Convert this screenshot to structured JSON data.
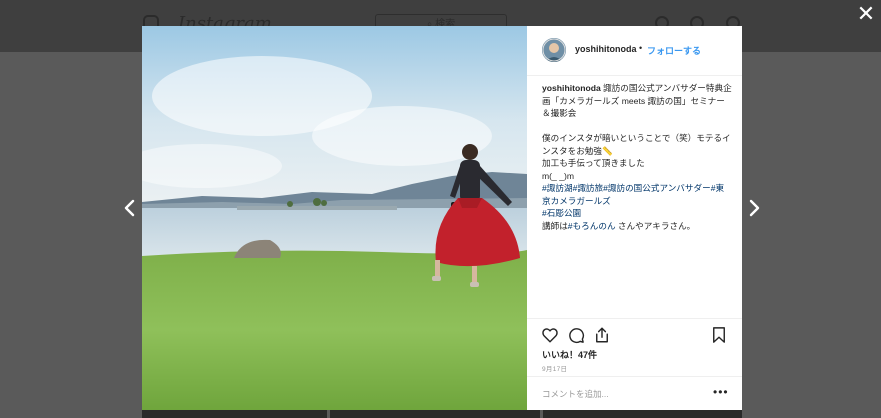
{
  "background": {
    "logo_text": "Instagram",
    "search_placeholder": "⌕ 検索"
  },
  "post": {
    "username": "yoshihitonoda",
    "separator": "•",
    "follow_label": "フォローする",
    "caption_user": "yoshihitonoda",
    "caption_lines": [
      {
        "text": " 諏訪の国公式アンバサダー特典企画「カメラガールズ meets 諏訪の国」セミナー＆撮影会\n\n僕のインスタが暗いということで（笑）モテるインスタをお勉強📏\n加工も手伝って頂きました\nm(_ _)m\n"
      }
    ],
    "hashtags": [
      "#諏訪湖",
      "#諏訪旅",
      "#諏訪の国公式アンバサダー",
      "#東京カメラガールズ",
      "#石彫公園"
    ],
    "lecturer_prefix": "講師は",
    "lecturer_tag": "#もろんのん",
    "lecturer_suffix": " さんやアキラさん。",
    "likes": "いいね！47件",
    "date": "9月17日",
    "comment_placeholder": "コメントを追加...",
    "more_label": "•••"
  },
  "controls": {
    "close_label": "✕"
  },
  "colors": {
    "link": "#3897f0",
    "hashtag": "#003569",
    "text": "#262626"
  }
}
